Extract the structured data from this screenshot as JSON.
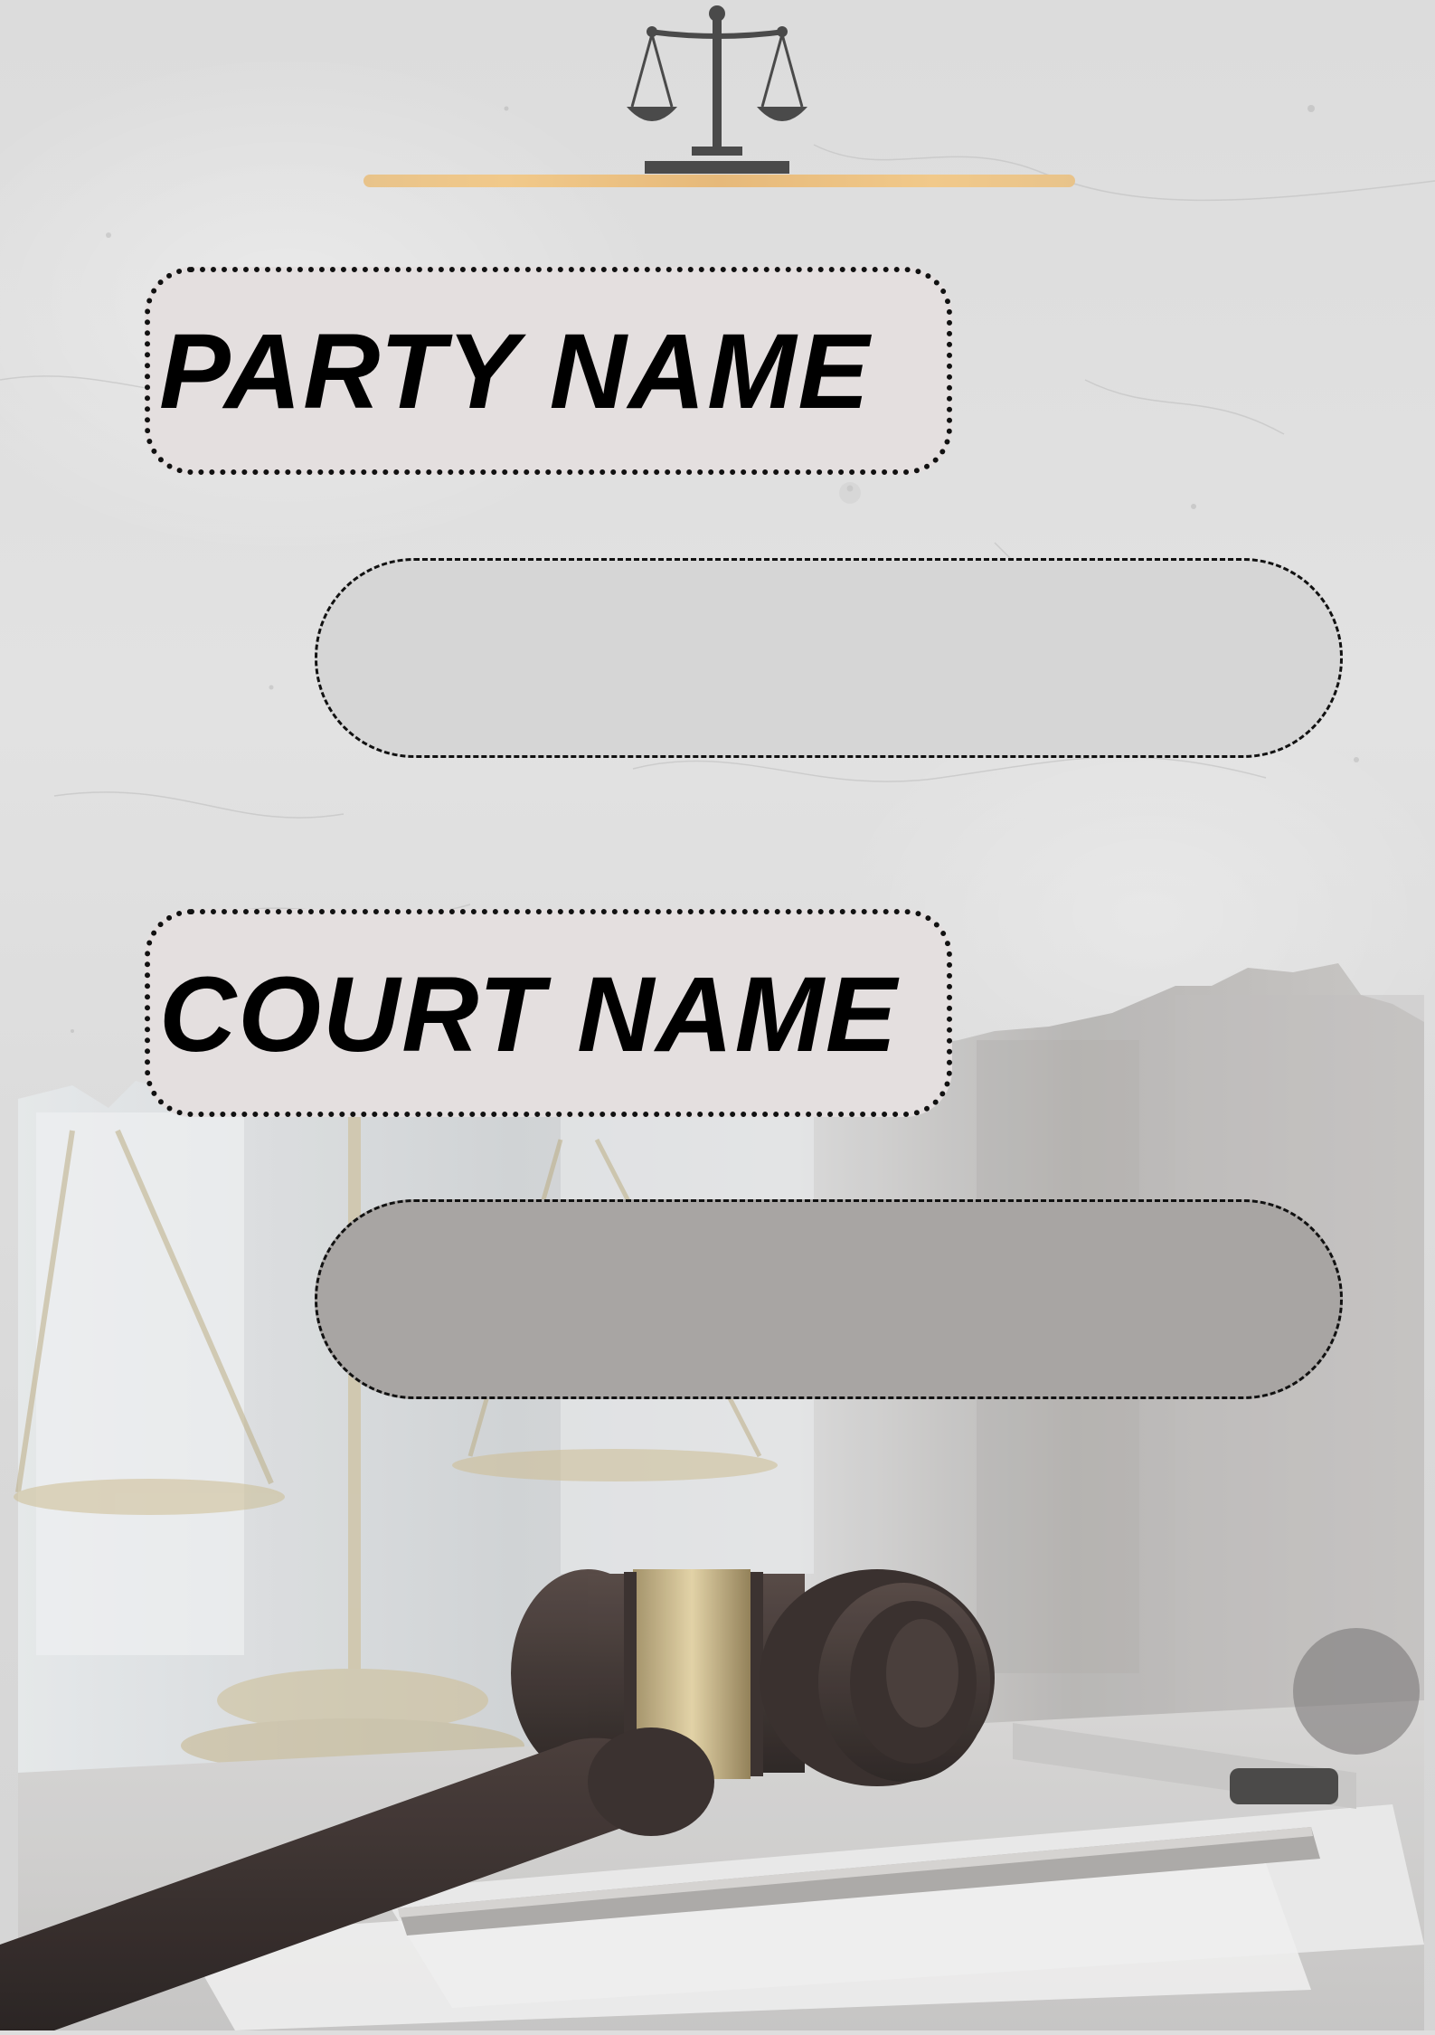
{
  "labels": {
    "party": "PARTY NAME",
    "court": "COURT NAME"
  },
  "fields": {
    "party_value": "",
    "court_value": ""
  },
  "icons": {
    "logo": "scales-of-justice-icon",
    "background_photo": "gavel-and-scales-photo"
  },
  "colors": {
    "background": "#dedede",
    "accent_rule": "#f1c98a",
    "label_fill": "#e4dfdf",
    "field_1_fill": "#d6d6d6",
    "field_2_fill": "#a8a5a3",
    "text": "#000000"
  }
}
